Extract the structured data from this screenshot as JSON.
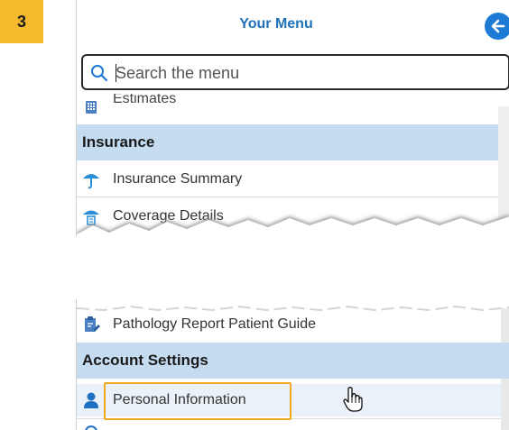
{
  "step": {
    "number": "3"
  },
  "menu": {
    "title": "Your Menu",
    "search_placeholder": "Search the menu",
    "items_top": [
      {
        "label": "Estimates",
        "icon": "calculator-icon"
      }
    ],
    "sections": [
      {
        "header": "Insurance",
        "items": [
          {
            "label": "Insurance Summary",
            "icon": "umbrella-icon"
          },
          {
            "label": "Coverage Details",
            "icon": "umbrella-document-icon"
          }
        ]
      },
      {
        "header": "Account Settings",
        "items": [
          {
            "label": "Personal Information",
            "icon": "person-icon",
            "highlighted": true
          }
        ]
      }
    ],
    "pre_section_item": {
      "label": "Pathology Report Patient Guide",
      "icon": "clipboard-edit-icon"
    }
  },
  "colors": {
    "accent": "#1d71b8",
    "section_bg": "#c5dcf0",
    "badge": "#f5b92e",
    "highlight": "#f0a91e"
  }
}
